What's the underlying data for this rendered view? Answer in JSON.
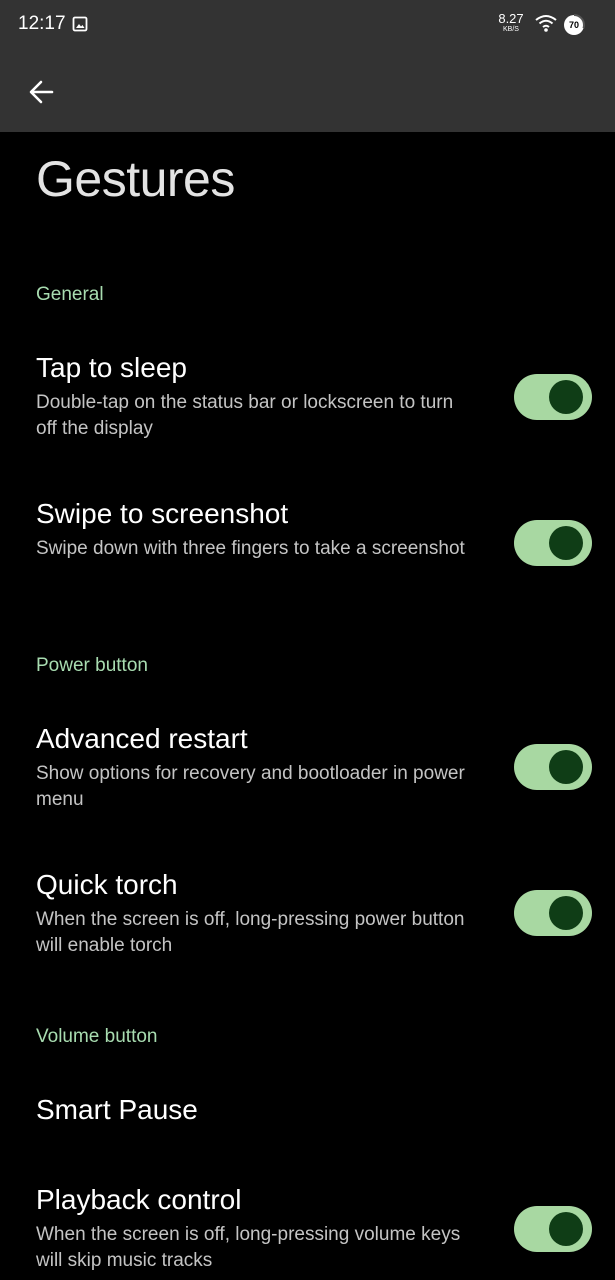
{
  "status_bar": {
    "time": "12:17",
    "net_speed_value": "8.27",
    "net_speed_unit": "KB/S",
    "battery_level": "70",
    "icons": [
      "image-notification-icon",
      "wifi-icon",
      "battery-icon"
    ]
  },
  "app_bar": {
    "back_icon": "arrow-back-icon"
  },
  "page": {
    "title": "Gestures"
  },
  "sections": {
    "general": "General",
    "power": "Power button",
    "volume": "Volume button"
  },
  "settings": {
    "tap_to_sleep": {
      "title": "Tap to sleep",
      "summary": "Double-tap on the status bar or lockscreen to turn off the display",
      "enabled": true
    },
    "swipe_screenshot": {
      "title": "Swipe to screenshot",
      "summary": "Swipe down with three fingers to take a screenshot",
      "enabled": true
    },
    "advanced_restart": {
      "title": "Advanced restart",
      "summary": "Show options for recovery and bootloader in power menu",
      "enabled": true
    },
    "quick_torch": {
      "title": "Quick torch",
      "summary": "When the screen is off, long-pressing power button will enable torch",
      "enabled": true
    },
    "smart_pause": {
      "title": "Smart Pause"
    },
    "playback_control": {
      "title": "Playback control",
      "summary": "When the screen is off, long-pressing volume keys will skip music tracks",
      "enabled": true
    }
  },
  "colors": {
    "status_bar_bg": "#333333",
    "background": "#000000",
    "accent": "#a8dcb0",
    "toggle_track_on": "#a8d8a2",
    "toggle_thumb_on": "#0f3d16"
  }
}
